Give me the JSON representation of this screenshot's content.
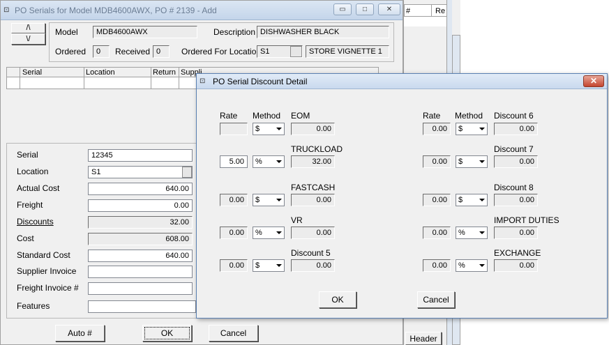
{
  "main": {
    "title": "PO Serials for Model MDB4600AWX, PO # 2139 - Add",
    "controls": {
      "minimize": "▭",
      "maximize": "□",
      "close": "✕"
    },
    "nav": {
      "up": "/\\",
      "down": "\\/"
    },
    "header": {
      "model_label": "Model",
      "model_value": "MDB4600AWX",
      "description_label": "Description",
      "description_value": "DISHWASHER BLACK",
      "ordered_label": "Ordered",
      "ordered_value": "0",
      "received_label": "Received",
      "received_value": "0",
      "ordered_for_location_label": "Ordered For Location",
      "location_code": "S1",
      "location_name": "STORE VIGNETTE 1"
    },
    "grid": {
      "columns": [
        "Serial",
        "Location",
        "Return",
        "Suppli"
      ]
    },
    "detail": {
      "serial_label": "Serial",
      "serial_value": "12345",
      "location_label": "Location",
      "location_value": "S1",
      "actual_cost_label": "Actual Cost",
      "actual_cost_value": "640.00",
      "freight_label": "Freight",
      "freight_value": "0.00",
      "discounts_label": "Discounts",
      "discounts_value": "32.00",
      "cost_label": "Cost",
      "cost_value": "608.00",
      "standard_cost_label": "Standard Cost",
      "standard_cost_value": "640.00",
      "supplier_invoice_label": "Supplier Invoice",
      "supplier_invoice_value": "",
      "freight_invoice_label": "Freight Invoice #",
      "freight_invoice_value": "",
      "features_label": "Features",
      "features_value": ""
    },
    "buttons": {
      "auto": "Auto #",
      "ok": "OK",
      "cancel": "Cancel"
    }
  },
  "right_window": {
    "col1": "#",
    "col2": "Re",
    "header_button": "Header"
  },
  "dialog": {
    "title": "PO Serial Discount Detail",
    "close": "✕",
    "rate_header": "Rate",
    "method_header": "Method",
    "left": [
      {
        "name": "EOM",
        "rate": "",
        "method": "$",
        "amount": "0.00"
      },
      {
        "name": "TRUCKLOAD",
        "rate": "5.00",
        "method": "%",
        "amount": "32.00"
      },
      {
        "name": "FASTCASH",
        "rate": "0.00",
        "method": "$",
        "amount": "0.00"
      },
      {
        "name": "VR",
        "rate": "0.00",
        "method": "%",
        "amount": "0.00"
      },
      {
        "name": "Discount 5",
        "rate": "0.00",
        "method": "$",
        "amount": "0.00"
      }
    ],
    "right": [
      {
        "name": "Discount 6",
        "rate": "0.00",
        "method": "$",
        "amount": "0.00"
      },
      {
        "name": "Discount 7",
        "rate": "0.00",
        "method": "$",
        "amount": "0.00"
      },
      {
        "name": "Discount 8",
        "rate": "0.00",
        "method": "$",
        "amount": "0.00"
      },
      {
        "name": "IMPORT DUTIES",
        "rate": "0.00",
        "method": "%",
        "amount": "0.00"
      },
      {
        "name": "EXCHANGE",
        "rate": "0.00",
        "method": "%",
        "amount": "0.00"
      }
    ],
    "ok": "OK",
    "cancel": "Cancel"
  }
}
